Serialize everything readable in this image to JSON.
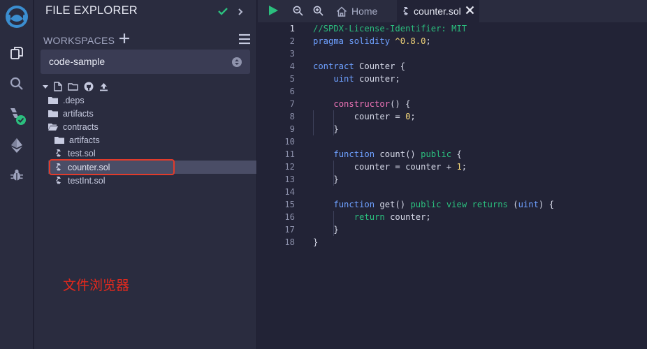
{
  "colors": {
    "accent_blue": "#6ea0ff",
    "accent_green": "#2bbf7e",
    "keyword_pink": "#ec73b6",
    "highlight_red": "#e23b2b",
    "selection": "#4a4d66"
  },
  "iconbar": {
    "items": [
      {
        "name": "remix-logo-icon"
      },
      {
        "name": "file-explorer-icon"
      },
      {
        "name": "search-icon"
      },
      {
        "name": "solidity-compiler-icon"
      },
      {
        "name": "deploy-run-icon"
      },
      {
        "name": "debugger-icon"
      }
    ]
  },
  "panel": {
    "title": "FILE EXPLORER",
    "workspaces_label": "WORKSPACES",
    "workspace_selected": "code-sample",
    "tree": [
      {
        "label": ".deps",
        "type": "folder"
      },
      {
        "label": "artifacts",
        "type": "folder"
      },
      {
        "label": "contracts",
        "type": "folder-open"
      },
      {
        "label": "artifacts",
        "type": "folder"
      },
      {
        "label": "test.sol",
        "type": "file"
      },
      {
        "label": "counter.sol",
        "type": "file",
        "selected": true
      },
      {
        "label": "testInt.sol",
        "type": "file"
      }
    ]
  },
  "annotation": "文件浏览器",
  "tabs": {
    "home_label": "Home",
    "active_label": "counter.sol"
  },
  "editor": {
    "current_line": 1,
    "line_numbers": [
      "1",
      "2",
      "3",
      "4",
      "5",
      "6",
      "7",
      "8",
      "9",
      "10",
      "11",
      "12",
      "13",
      "14",
      "15",
      "16",
      "17",
      "18"
    ],
    "lines": [
      "//SPDX-License-Identifier: MIT",
      "pragma solidity ^0.8.0;",
      "",
      "contract Counter {",
      "    uint counter;",
      "",
      "    constructor() {",
      "        counter = 0;",
      "    }",
      "",
      "    function count() public {",
      "        counter = counter + 1;",
      "    }",
      "",
      "    function get() public view returns (uint) {",
      "        return counter;",
      "    }",
      "}"
    ]
  }
}
